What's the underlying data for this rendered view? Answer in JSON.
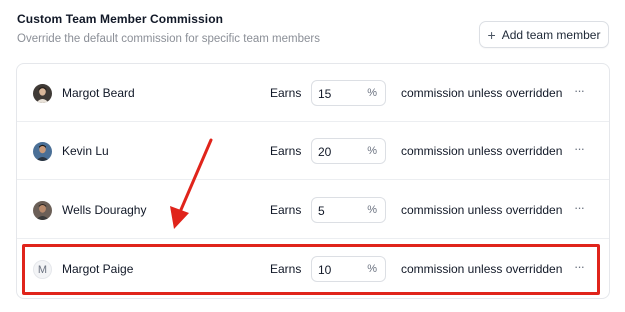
{
  "section": {
    "title": "Custom Team Member Commission",
    "subtitle": "Override the default commission for specific team members",
    "add_button_label": "Add team member"
  },
  "members": [
    {
      "name": "Margot Beard",
      "earns_label": "Earns",
      "commission": "15",
      "unit": "%",
      "description": "commission unless overridden",
      "avatar": "photo",
      "avatar_initial": ""
    },
    {
      "name": "Kevin Lu",
      "earns_label": "Earns",
      "commission": "20",
      "unit": "%",
      "description": "commission unless overridden",
      "avatar": "photo",
      "avatar_initial": ""
    },
    {
      "name": "Wells Douraghy",
      "earns_label": "Earns",
      "commission": "5",
      "unit": "%",
      "description": "commission unless overridden",
      "avatar": "photo",
      "avatar_initial": ""
    },
    {
      "name": "Margot Paige",
      "earns_label": "Earns",
      "commission": "10",
      "unit": "%",
      "description": "commission unless overridden",
      "avatar": "initial",
      "avatar_initial": "M"
    }
  ],
  "more_icon": "ellipsis-icon",
  "annotation": {
    "color": "#e0241b"
  }
}
